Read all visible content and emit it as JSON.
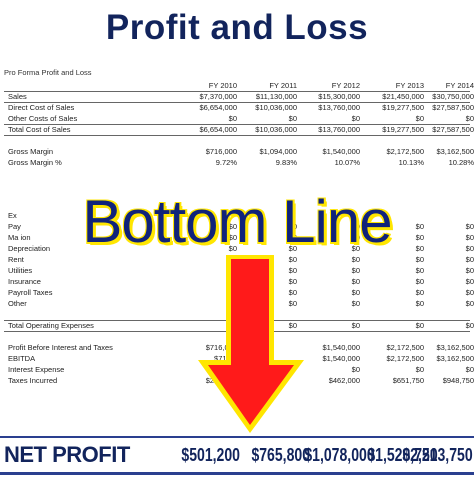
{
  "title": "Profit and Loss",
  "subtitle": "Pro Forma Profit and Loss",
  "columns": [
    "FY 2010",
    "FY 2011",
    "FY 2012",
    "FY 2013",
    "FY 2014"
  ],
  "rows": [
    {
      "label": "Sales",
      "values": [
        "$7,370,000",
        "$11,130,000",
        "$15,300,000",
        "$21,450,000",
        "$30,750,000"
      ]
    },
    {
      "label": "Direct Cost of Sales",
      "values": [
        "$6,654,000",
        "$10,036,000",
        "$13,760,000",
        "$19,277,500",
        "$27,587,500"
      ]
    },
    {
      "label": "Other Costs of Sales",
      "values": [
        "$0",
        "$0",
        "$0",
        "$0",
        "$0"
      ]
    },
    {
      "label": "Total Cost of Sales",
      "values": [
        "$6,654,000",
        "$10,036,000",
        "$13,760,000",
        "$19,277,500",
        "$27,587,500"
      ]
    },
    {
      "label": "Gross Margin",
      "values": [
        "$716,000",
        "$1,094,000",
        "$1,540,000",
        "$2,172,500",
        "$3,162,500"
      ]
    },
    {
      "label": "Gross Margin %",
      "values": [
        "9.72%",
        "9.83%",
        "10.07%",
        "10.13%",
        "10.28%"
      ]
    },
    {
      "label": "Ex",
      "values": [
        "",
        "",
        "",
        "",
        ""
      ]
    },
    {
      "label": "Pay",
      "values": [
        "$0",
        "$0",
        "$0",
        "$0",
        "$0"
      ]
    },
    {
      "label": "Ma                   ion",
      "values": [
        "$0",
        "$0",
        "$0",
        "$0",
        "$0"
      ]
    },
    {
      "label": "Depreciation",
      "values": [
        "$0",
        "$0",
        "$0",
        "$0",
        "$0"
      ]
    },
    {
      "label": "Rent",
      "values": [
        "$0",
        "$0",
        "$0",
        "$0",
        "$0"
      ]
    },
    {
      "label": "Utilities",
      "values": [
        "$0",
        "$0",
        "$0",
        "$0",
        "$0"
      ]
    },
    {
      "label": "Insurance",
      "values": [
        "$0",
        "$0",
        "$0",
        "$0",
        "$0"
      ]
    },
    {
      "label": "Payroll Taxes",
      "values": [
        "$0",
        "$0",
        "$0",
        "$0",
        "$0"
      ]
    },
    {
      "label": "Other",
      "values": [
        "$0",
        "$0",
        "$0",
        "$0",
        "$0"
      ]
    },
    {
      "label": "Total Operating Expenses",
      "values": [
        "$0",
        "$0",
        "$0",
        "$0",
        "$0"
      ]
    },
    {
      "label": "Profit Before Interest and Taxes",
      "values": [
        "$716,000",
        "",
        "$1,540,000",
        "$2,172,500",
        "$3,162,500"
      ]
    },
    {
      "label": "EBITDA",
      "values": [
        "$716,0",
        "",
        "$1,540,000",
        "$2,172,500",
        "$3,162,500"
      ]
    },
    {
      "label": "Interest Expense",
      "values": [
        "$0",
        "",
        "$0",
        "$0",
        "$0"
      ]
    },
    {
      "label": "Taxes Incurred",
      "values": [
        "$214,800",
        "",
        "$462,000",
        "$651,750",
        "$948,750"
      ]
    }
  ],
  "bottom_line": "Bottom Line",
  "net_profit": {
    "label": "NET PROFIT",
    "values": [
      "$501,200",
      "$765,800",
      "$1,078,000",
      "$1,520,750",
      "$2,213,750"
    ]
  }
}
